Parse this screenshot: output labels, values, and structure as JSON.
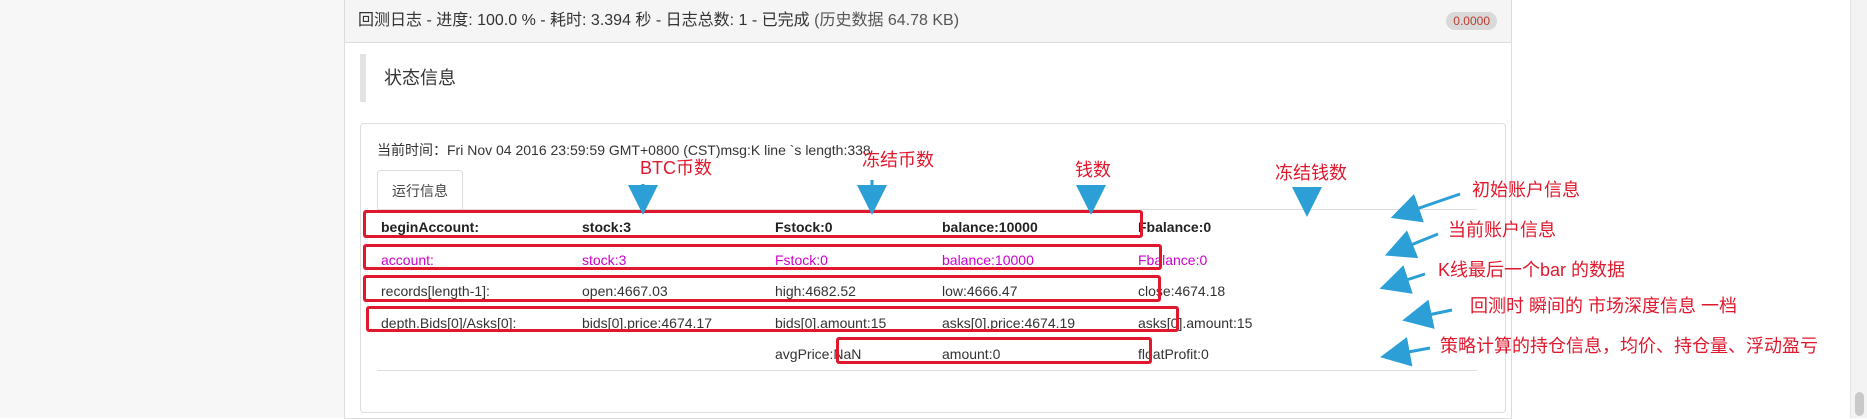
{
  "header": {
    "title": "回测日志 - 进度: 100.0 % - 耗时: 3.394 秒 - 日志总数: 1 - 已完成",
    "history": "(历史数据 64.78 KB)",
    "badge": "0.0000"
  },
  "section": {
    "title": "状态信息"
  },
  "status": {
    "current_time": "当前时间：Fri Nov 04 2016 23:59:59 GMT+0800 (CST)msg:K line `s length:338",
    "tab": "运行信息",
    "rows": [
      {
        "cells": [
          "beginAccount:",
          "stock:3",
          "Fstock:0",
          "balance:10000",
          "Fbalance:0"
        ],
        "style": "bold"
      },
      {
        "cells": [
          "account:",
          "stock:3",
          "Fstock:0",
          "balance:10000",
          "Fbalance:0"
        ],
        "style": "magenta"
      },
      {
        "cells": [
          "records[length-1]:",
          "open:4667.03",
          "high:4682.52",
          "low:4666.47",
          "close:4674.18"
        ],
        "style": "normal"
      },
      {
        "cells": [
          "depth.Bids[0]/Asks[0]:",
          "bids[0].price:4674.17",
          "bids[0].amount:15",
          "asks[0].price:4674.19",
          "asks[0].amount:15"
        ],
        "style": "normal"
      },
      {
        "cells": [
          "",
          "",
          "avgPrice:NaN",
          "amount:0",
          "floatProfit:0"
        ],
        "style": "normal"
      }
    ]
  },
  "annotations": {
    "column_labels": [
      "BTC币数",
      "冻结币数",
      "钱数",
      "冻结钱数"
    ],
    "row_notes": [
      "初始账户信息",
      "当前账户信息",
      "K线最后一个bar 的数据",
      "回测时 瞬间的 市场深度信息 一档",
      "策略计算的持仓信息，均价、持仓量、浮动盈亏"
    ],
    "color": "#e0182d",
    "arrow_color": "#2b9fd6"
  }
}
